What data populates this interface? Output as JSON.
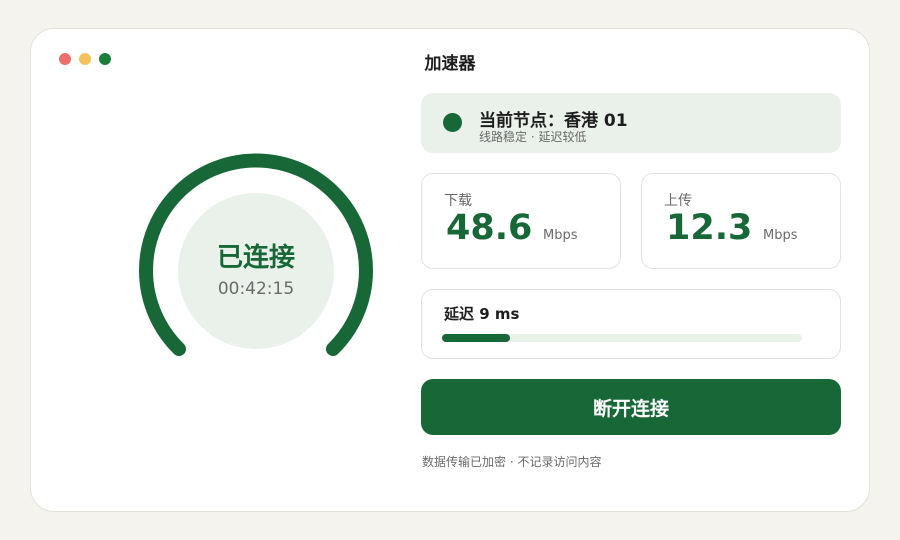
{
  "window": {
    "title": "加速器"
  },
  "status": {
    "label": "已连接",
    "elapsed": "00:42:15"
  },
  "node": {
    "title": "当前节点：香港 01",
    "subtitle": "线路稳定 · 延迟较低"
  },
  "download": {
    "label": "下载",
    "value": "48.6",
    "unit": "Mbps"
  },
  "upload": {
    "label": "上传",
    "value": "12.3",
    "unit": "Mbps"
  },
  "latency": {
    "text": "延迟 9 ms",
    "level_fraction": 0.19
  },
  "actions": {
    "disconnect_label": "断开连接"
  },
  "footer": {
    "note": "数据传输已加密 · 不记录访问内容"
  },
  "colors": {
    "accent": "#186737",
    "accent_light": "#eaf1eb",
    "traffic_red": "#ec6f6b",
    "traffic_yellow": "#f1c25e",
    "traffic_green": "#1c7d3a"
  }
}
